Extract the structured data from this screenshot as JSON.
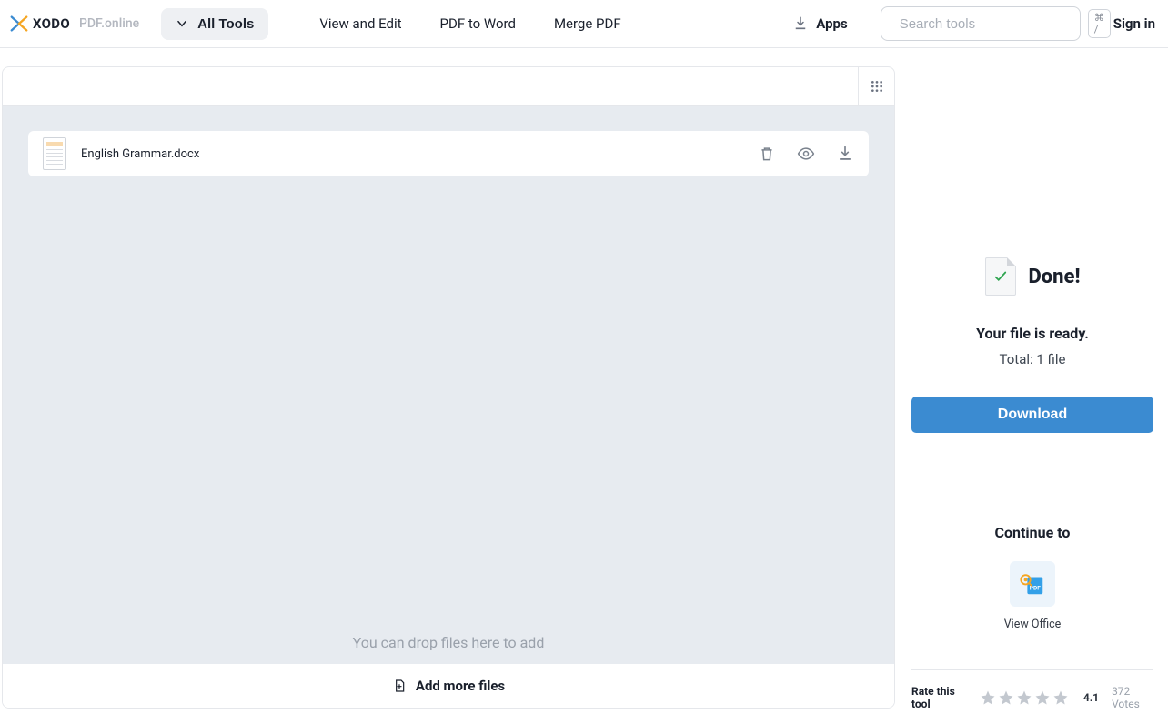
{
  "brand": {
    "name": "XODO",
    "sub": "PDF.online"
  },
  "header": {
    "all_tools": "All Tools",
    "nav": {
      "view_edit": "View and Edit",
      "pdf_to_word": "PDF to Word",
      "merge_pdf": "Merge PDF"
    },
    "apps": "Apps",
    "search_placeholder": "Search tools",
    "shortcut": "⌘ /",
    "sign_in": "Sign in"
  },
  "file_panel": {
    "file_name": "English Grammar.docx",
    "drop_hint": "You can drop files here to add",
    "add_more": "Add more files"
  },
  "status": {
    "done": "Done!",
    "ready": "Your file is ready.",
    "total": "Total: 1 file",
    "download": "Download"
  },
  "continue": {
    "title": "Continue to",
    "action_label": "View Office"
  },
  "rating": {
    "label": "Rate this tool",
    "score": "4.1",
    "votes": "372 Votes"
  },
  "colors": {
    "accent": "#3b8bd1",
    "panel_bg": "#e7ebf0"
  }
}
